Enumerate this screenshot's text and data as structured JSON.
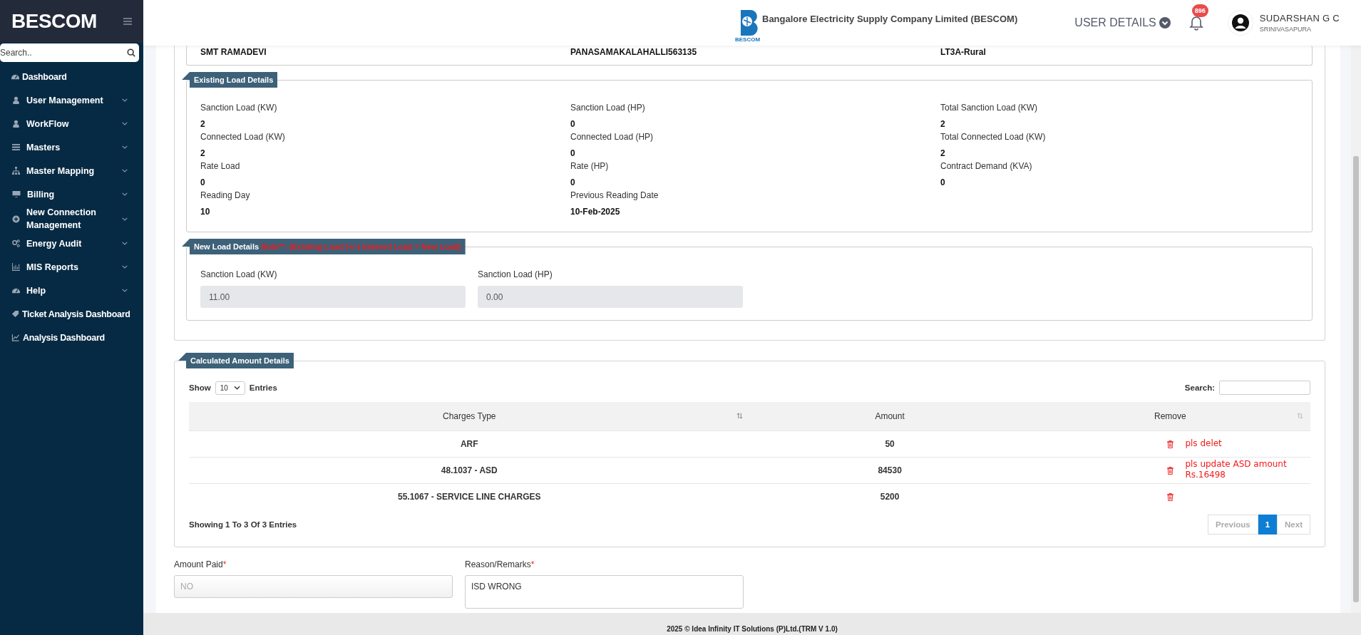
{
  "sidebar": {
    "logo": "BESCOM",
    "search": {
      "placeholder": "Search.."
    },
    "items": [
      {
        "label": "Dashboard",
        "expandable": false
      },
      {
        "label": "User Management",
        "expandable": true
      },
      {
        "label": "WorkFlow",
        "expandable": true
      },
      {
        "label": "Masters",
        "expandable": true
      },
      {
        "label": "Master Mapping",
        "expandable": true
      },
      {
        "label": "Billing",
        "expandable": true
      },
      {
        "label": "New Connection Management",
        "expandable": true
      },
      {
        "label": "Energy Audit",
        "expandable": true
      },
      {
        "label": "MIS Reports",
        "expandable": true
      },
      {
        "label": "Help",
        "expandable": true
      },
      {
        "label": "Ticket Analysis Dashboard",
        "expandable": false
      },
      {
        "label": "Analysis Dashboard",
        "expandable": false
      }
    ]
  },
  "header": {
    "logo_caption": "BESCOM",
    "company": "Bangalore Electricity Supply Company Limited (BESCOM)",
    "user_details": "USER DETAILS",
    "notification_count": "896",
    "user": {
      "name": "SUDARSHAN G C",
      "location": "SRINIVASAPURA"
    }
  },
  "consumer_row": [
    "SMT RAMADEVI",
    "PANASAMAKALAHALLI563135",
    "LT3A-Rural"
  ],
  "existing_load": {
    "title": "Existing Load Details",
    "fields": [
      {
        "label": "Sanction Load (KW)",
        "value": "2"
      },
      {
        "label": "Sanction Load (HP)",
        "value": "0"
      },
      {
        "label": "Total Sanction Load (KW)",
        "value": "2"
      },
      {
        "label": "Connected Load (KW)",
        "value": "2"
      },
      {
        "label": "Connected Load (HP)",
        "value": "0"
      },
      {
        "label": "Total Connected Load (KW)",
        "value": "2"
      },
      {
        "label": "Rate Load",
        "value": "0"
      },
      {
        "label": "Rate (HP)",
        "value": "0"
      },
      {
        "label": "Contract Demand (KVA)",
        "value": "0"
      },
      {
        "label": "Reading Day",
        "value": "10"
      },
      {
        "label": "Previous Reading Date",
        "value": "10-Feb-2025"
      }
    ]
  },
  "new_load": {
    "title": "New Load Details",
    "note": "Note**: (Existing Load (+/-) Entered Load = New Load)",
    "fields": [
      {
        "label": "Sanction Load (KW)",
        "value": "11.00"
      },
      {
        "label": "Sanction Load (HP)",
        "value": "0.00"
      }
    ]
  },
  "calculated": {
    "title": "Calculated Amount Details",
    "show_label": "Show",
    "page_size": "10",
    "entries_label": "Entries",
    "search_label": "Search:",
    "columns": [
      {
        "label": "Charges Type",
        "sortable": true
      },
      {
        "label": "Amount",
        "sortable": false
      },
      {
        "label": "Remove",
        "sortable": true
      }
    ],
    "rows": [
      {
        "charges_type": "ARF",
        "amount": "50",
        "annotation": "pls delet"
      },
      {
        "charges_type": "48.1037 - ASD",
        "amount": "84530",
        "annotation": "pls update ASD amount Rs.16498"
      },
      {
        "charges_type": "55.1067 - SERVICE LINE CHARGES",
        "amount": "5200"
      }
    ],
    "summary": "Showing 1 To 3 Of 3 Entries",
    "pagination": {
      "previous": "Previous",
      "pages": [
        {
          "label": "1",
          "selected": true
        }
      ],
      "next": "Next"
    }
  },
  "amount_paid": {
    "label": "Amount Paid",
    "required_mark": "*",
    "value": "NO",
    "disabled": true
  },
  "remarks": {
    "label": "Reason/Remarks",
    "required_mark": "*",
    "value": "ISD WRONG"
  },
  "footer": "2025 © Idea Infinity IT Solutions (P)Ltd.(TRM V 1.0)"
}
